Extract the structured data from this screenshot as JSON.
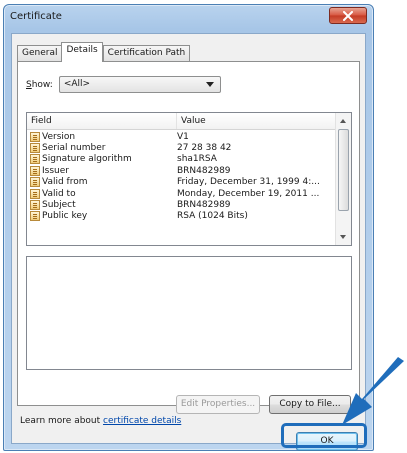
{
  "window": {
    "title": "Certificate",
    "close_symbol": "✕"
  },
  "tabs": [
    {
      "label": "General"
    },
    {
      "label": "Details"
    },
    {
      "label": "Certification Path"
    }
  ],
  "show": {
    "label_prefix": "S",
    "label_rest": "how:",
    "selected": "<All>"
  },
  "list": {
    "headers": {
      "field": "Field",
      "value": "Value"
    },
    "rows": [
      {
        "field": "Version",
        "value": "V1"
      },
      {
        "field": "Serial number",
        "value": "27 28 38 42"
      },
      {
        "field": "Signature algorithm",
        "value": "sha1RSA"
      },
      {
        "field": "Issuer",
        "value": "BRN482989"
      },
      {
        "field": "Valid from",
        "value": "Friday, December 31, 1999 4:..."
      },
      {
        "field": "Valid to",
        "value": "Monday, December 19, 2011 ..."
      },
      {
        "field": "Subject",
        "value": "BRN482989"
      },
      {
        "field": "Public key",
        "value": "RSA (1024 Bits)"
      }
    ]
  },
  "buttons": {
    "edit_properties": "Edit Properties...",
    "copy_to_file": "Copy to File...",
    "ok": "OK"
  },
  "learn_more": {
    "prefix": "Learn more about ",
    "link": "certificate details"
  },
  "colors": {
    "accent_arrow": "#1f6dbb",
    "link": "#0047ab"
  }
}
